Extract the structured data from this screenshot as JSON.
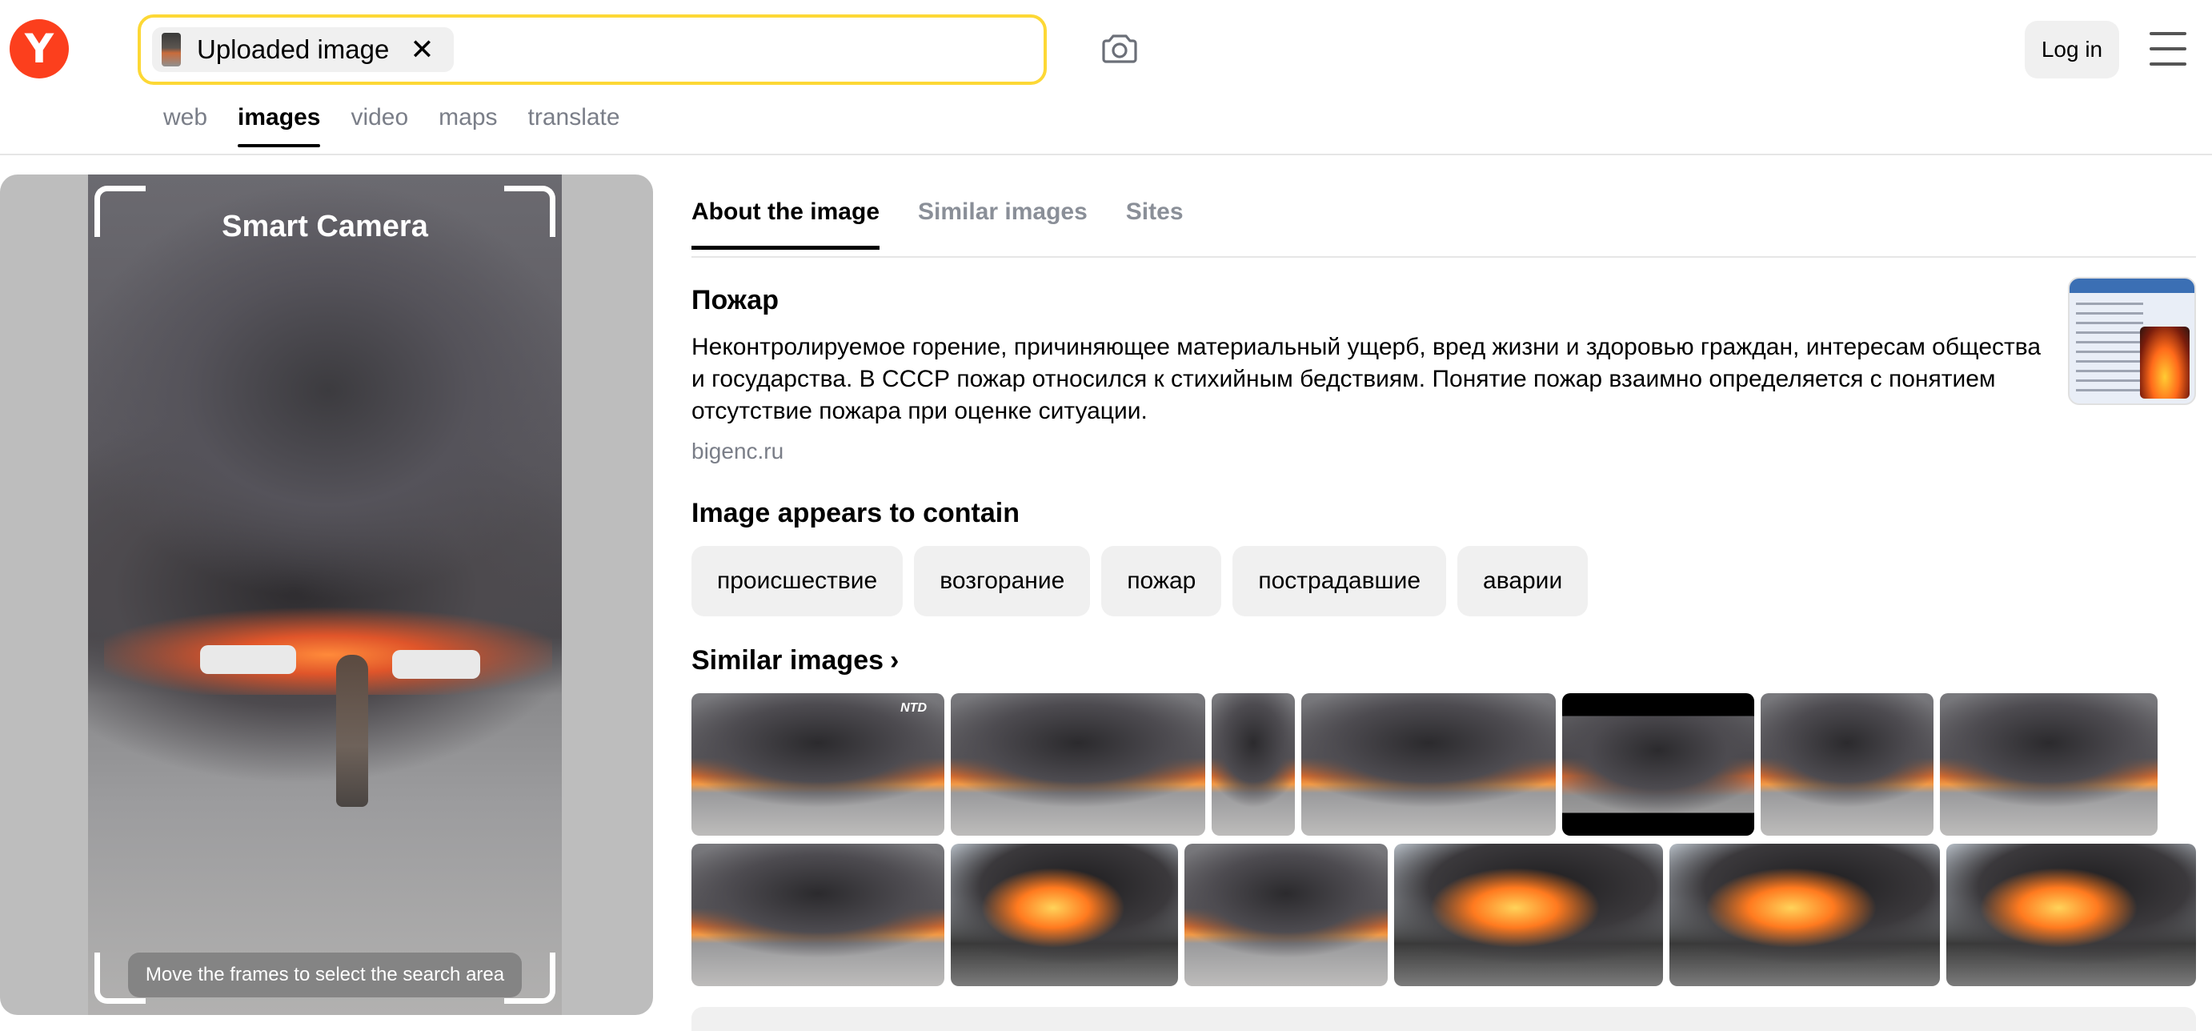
{
  "header": {
    "logo_letter": "Y",
    "search": {
      "chip_label": "Uploaded image",
      "close_glyph": "✕"
    },
    "camera_icon": "camera-search-icon",
    "login_label": "Log in",
    "menu_icon": "hamburger-menu-icon"
  },
  "nav": {
    "items": [
      {
        "label": "web",
        "active": false
      },
      {
        "label": "images",
        "active": true
      },
      {
        "label": "video",
        "active": false
      },
      {
        "label": "maps",
        "active": false
      },
      {
        "label": "translate",
        "active": false
      }
    ]
  },
  "smart_camera": {
    "title": "Smart Camera",
    "hint": "Move the frames to select the search area"
  },
  "tabs": [
    {
      "label": "About the image",
      "active": true
    },
    {
      "label": "Similar images",
      "active": false
    },
    {
      "label": "Sites",
      "active": false
    }
  ],
  "entity": {
    "title": "Пожар",
    "description": "Неконтролируемое горение, причиняющее материальный ущерб, вред жизни и здоровью граждан, интересам общества и государства. В СССР пожар относился к стихийным бедствиям. Понятие пожар взаимно определяется с понятием отсутствие пожара при оценке ситуации.",
    "source": "bigenc.ru"
  },
  "contains": {
    "title": "Image appears to contain",
    "tags": [
      "происшествие",
      "возгорание",
      "пожар",
      "пострадавшие",
      "аварии"
    ]
  },
  "similar": {
    "title": "Similar images",
    "chevron": "›",
    "watermark": "NTD"
  },
  "colors": {
    "brand_red": "#fc3f1d",
    "search_border": "#fdd835",
    "muted_text": "#7a7e88"
  }
}
